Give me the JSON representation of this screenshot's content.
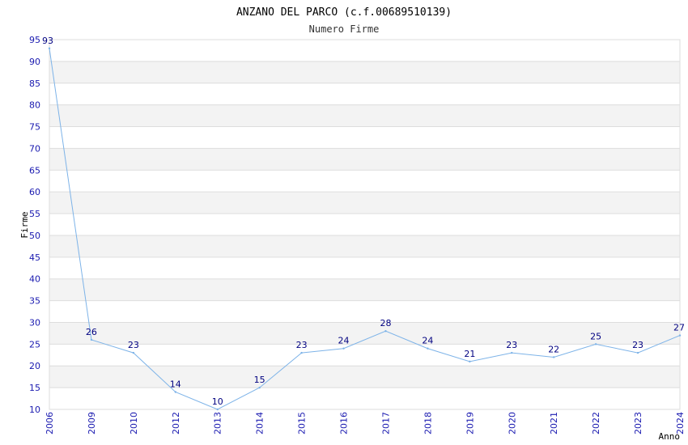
{
  "chart_data": {
    "type": "line",
    "title": "ANZANO DEL PARCO (c.f.00689510139)",
    "subtitle": "Numero Firme",
    "xlabel": "Anno",
    "ylabel": "Firme",
    "categories": [
      "2006",
      "2009",
      "2010",
      "2012",
      "2013",
      "2014",
      "2015",
      "2016",
      "2017",
      "2018",
      "2019",
      "2020",
      "2021",
      "2022",
      "2023",
      "2024"
    ],
    "series": [
      {
        "values": [
          93,
          26,
          23,
          14,
          10,
          15,
          23,
          24,
          28,
          24,
          21,
          23,
          22,
          25,
          23,
          27
        ]
      }
    ],
    "ylim": [
      10,
      95
    ],
    "ytick_step": 5,
    "grid": true,
    "colors": {
      "line": "#7db3e8",
      "band": "#f3f3f3",
      "grid": "#dddddd",
      "tick_text": "#1a1ab0",
      "label_text": "#000080"
    }
  }
}
